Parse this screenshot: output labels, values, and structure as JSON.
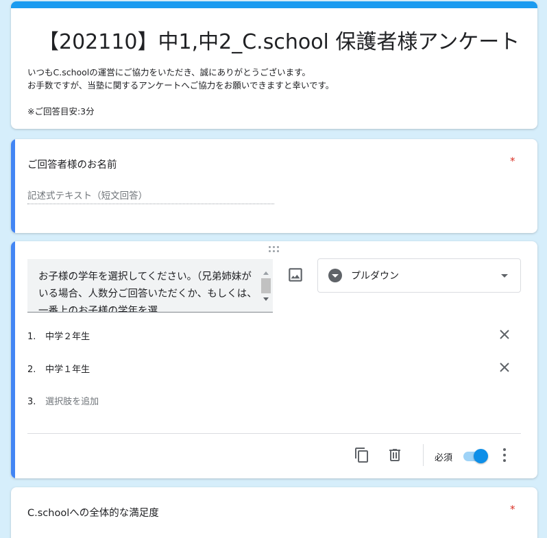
{
  "form": {
    "title": "【202110】中1,中2_C.school 保護者様アンケート",
    "description": [
      "いつもC.schoolの運営にご協力をいただき、誠にありがとうございます。",
      "お手数ですが、当塾に関するアンケートへご協力をお願いできますと幸いです。",
      "※ご回答目安:3分"
    ]
  },
  "questions": [
    {
      "title": "ご回答者様のお名前",
      "required_mark": "*",
      "answer_placeholder": "記述式テキスト（短文回答）"
    },
    {
      "title_text": "お子様の学年を選択してください。（兄弟姉妹がいる場合、人数分ご回答いただくか、もしくは、一番上のお子様の学年を選",
      "type_label": "プルダウン",
      "options": [
        {
          "num": "1.",
          "label": "中学２年生"
        },
        {
          "num": "2.",
          "label": "中学１年生"
        }
      ],
      "add_option": {
        "num": "3.",
        "label": "選択肢を追加"
      },
      "required_label": "必須",
      "required_on": true
    },
    {
      "title": "C.schoolへの全体的な満足度",
      "required_mark": "*"
    }
  ],
  "colors": {
    "accent": "#1a9bf0",
    "active_bar": "#4285f4",
    "background": "#d6eefb",
    "required": "#d93025"
  },
  "icons": [
    "drag-handle-icon",
    "image-icon",
    "dropdown-type-icon",
    "caret-down-icon",
    "close-icon",
    "duplicate-icon",
    "delete-icon",
    "more-vert-icon"
  ]
}
